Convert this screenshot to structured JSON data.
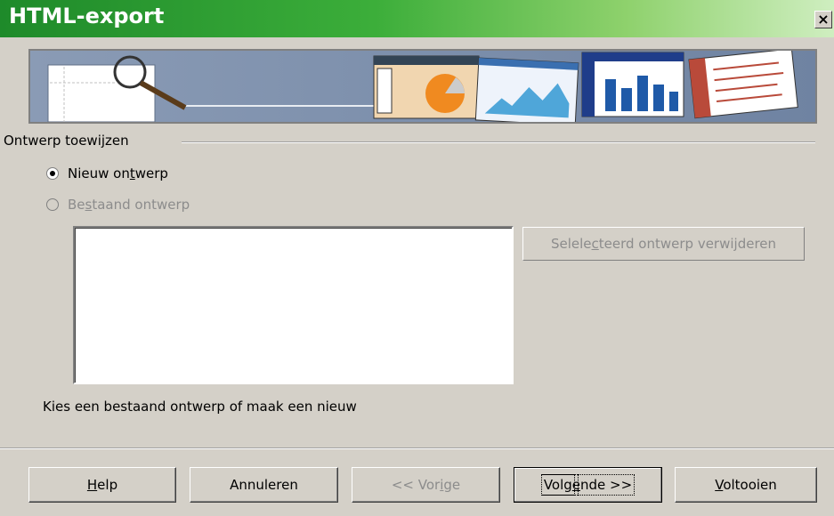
{
  "window": {
    "title": "HTML-export",
    "close_label": "×"
  },
  "group": {
    "label": "Ontwerp toewijzen"
  },
  "options": {
    "new_design": {
      "before": "Nieuw on",
      "accel": "t",
      "after": "werp",
      "checked": true
    },
    "existing_design": {
      "before": "Be",
      "accel": "s",
      "after": "taand ontwerp",
      "checked": false,
      "disabled": true
    }
  },
  "delete_button": {
    "before": "Selele",
    "accel": "c",
    "after": "teerd ontwerp verwijderen"
  },
  "hint": "Kies een bestaand ontwerp of maak een nieuw",
  "buttons": {
    "help": {
      "before": "",
      "accel": "H",
      "after": "elp"
    },
    "cancel": {
      "label": "Annuleren"
    },
    "prev": {
      "before": "<< Vor",
      "accel": "i",
      "after": "ge"
    },
    "next": {
      "before": "Volg",
      "accel": "e",
      "after": "nde >>"
    },
    "finish": {
      "before": "",
      "accel": "V",
      "after": "oltooien"
    }
  }
}
